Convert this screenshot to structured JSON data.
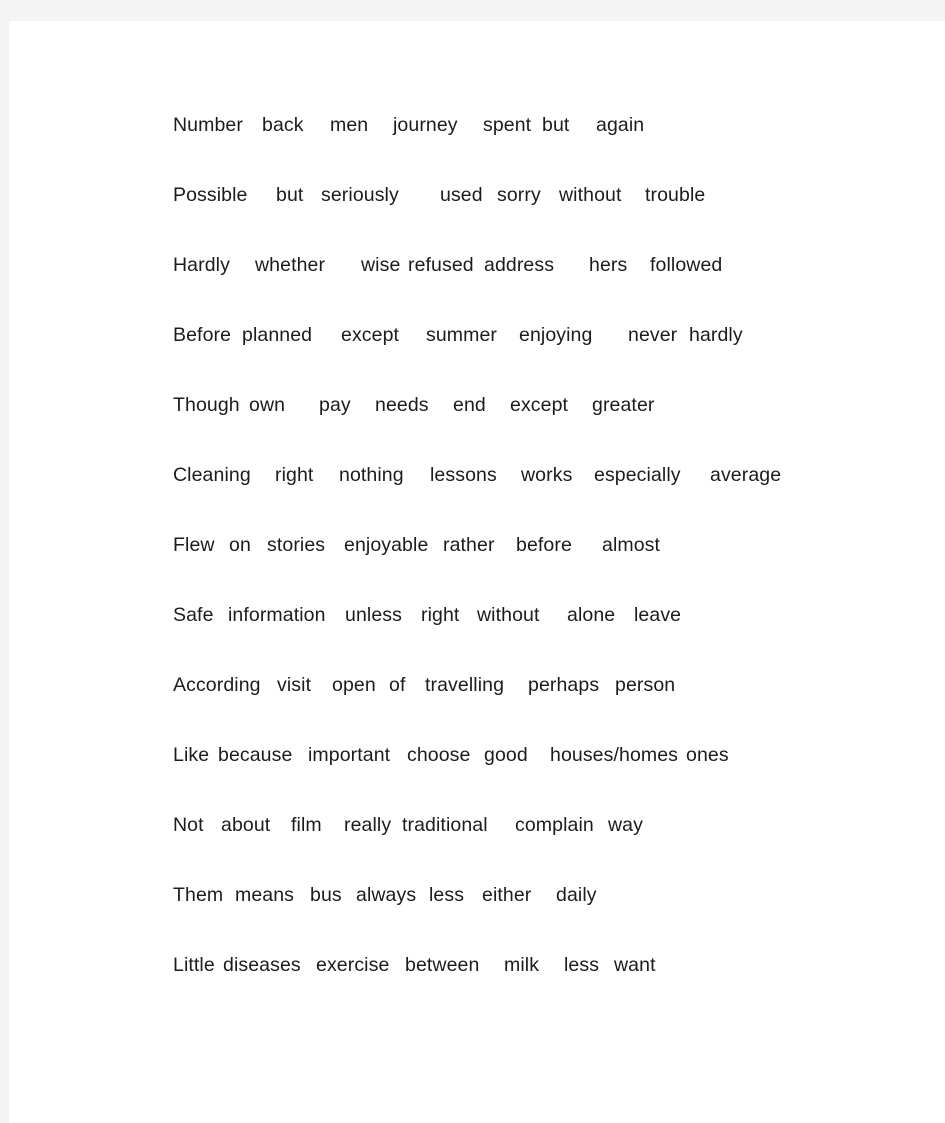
{
  "page": {
    "background_color": "#f4f4f4",
    "sheet_color": "#ffffff",
    "text_color": "#1c1c1c"
  },
  "document": {
    "type": "word-list",
    "row_count": 13,
    "rows": [
      {
        "id": "row-1",
        "words": [
          "Number",
          "back",
          "men",
          "journey",
          "spent",
          "but",
          "again"
        ]
      },
      {
        "id": "row-2",
        "words": [
          "Possible",
          "but",
          "seriously",
          "used",
          "sorry",
          "without",
          "trouble"
        ]
      },
      {
        "id": "row-3",
        "words": [
          "Hardly",
          "whether",
          "wise",
          "refused",
          "address",
          "hers",
          "followed"
        ]
      },
      {
        "id": "row-4",
        "words": [
          "Before",
          "planned",
          "except",
          "summer",
          "enjoying",
          "never",
          "hardly"
        ]
      },
      {
        "id": "row-5",
        "words": [
          "Though",
          "own",
          "pay",
          "needs",
          "end",
          "except",
          "greater"
        ]
      },
      {
        "id": "row-6",
        "words": [
          "Cleaning",
          "right",
          "nothing",
          "lessons",
          "works",
          "especially",
          "average"
        ]
      },
      {
        "id": "row-7",
        "words": [
          "Flew",
          "on",
          "stories",
          "enjoyable",
          "rather",
          "before",
          "almost"
        ]
      },
      {
        "id": "row-8",
        "words": [
          "Safe",
          "information",
          "unless",
          "right",
          "without",
          "alone",
          "leave"
        ]
      },
      {
        "id": "row-9",
        "words": [
          "According",
          "visit",
          "open",
          "of",
          "travelling",
          "perhaps",
          "person"
        ]
      },
      {
        "id": "row-10",
        "words": [
          "Like",
          "because",
          "important",
          "choose",
          "good",
          "houses/homes",
          "ones"
        ]
      },
      {
        "id": "row-11",
        "words": [
          "Not",
          "about",
          "film",
          "really",
          "traditional",
          "complain",
          "way"
        ]
      },
      {
        "id": "row-12",
        "words": [
          "Them",
          "means",
          "bus",
          "always",
          "less",
          "either",
          "daily"
        ]
      },
      {
        "id": "row-13",
        "words": [
          "Little",
          "diseases",
          "exercise",
          "between",
          "milk",
          "less",
          "want"
        ]
      }
    ],
    "word_offsets": [
      [
        9,
        98,
        166,
        229,
        319,
        378,
        432
      ],
      [
        9,
        112,
        157,
        276,
        333,
        395,
        481
      ],
      [
        9,
        91,
        197,
        244,
        320,
        425,
        486
      ],
      [
        9,
        78,
        177,
        262,
        355,
        464,
        525
      ],
      [
        9,
        85,
        155,
        211,
        289,
        346,
        428
      ],
      [
        9,
        111,
        175,
        266,
        357,
        430,
        546
      ],
      [
        9,
        65,
        103,
        180,
        279,
        352,
        438
      ],
      [
        9,
        64,
        181,
        257,
        313,
        403,
        470
      ],
      [
        9,
        113,
        168,
        225,
        261,
        364,
        451
      ],
      [
        9,
        54,
        144,
        243,
        320,
        386,
        522
      ],
      [
        9,
        57,
        127,
        180,
        238,
        351,
        444
      ],
      [
        9,
        71,
        146,
        192,
        265,
        318,
        392
      ],
      [
        9,
        59,
        152,
        241,
        340,
        400,
        450
      ]
    ]
  }
}
